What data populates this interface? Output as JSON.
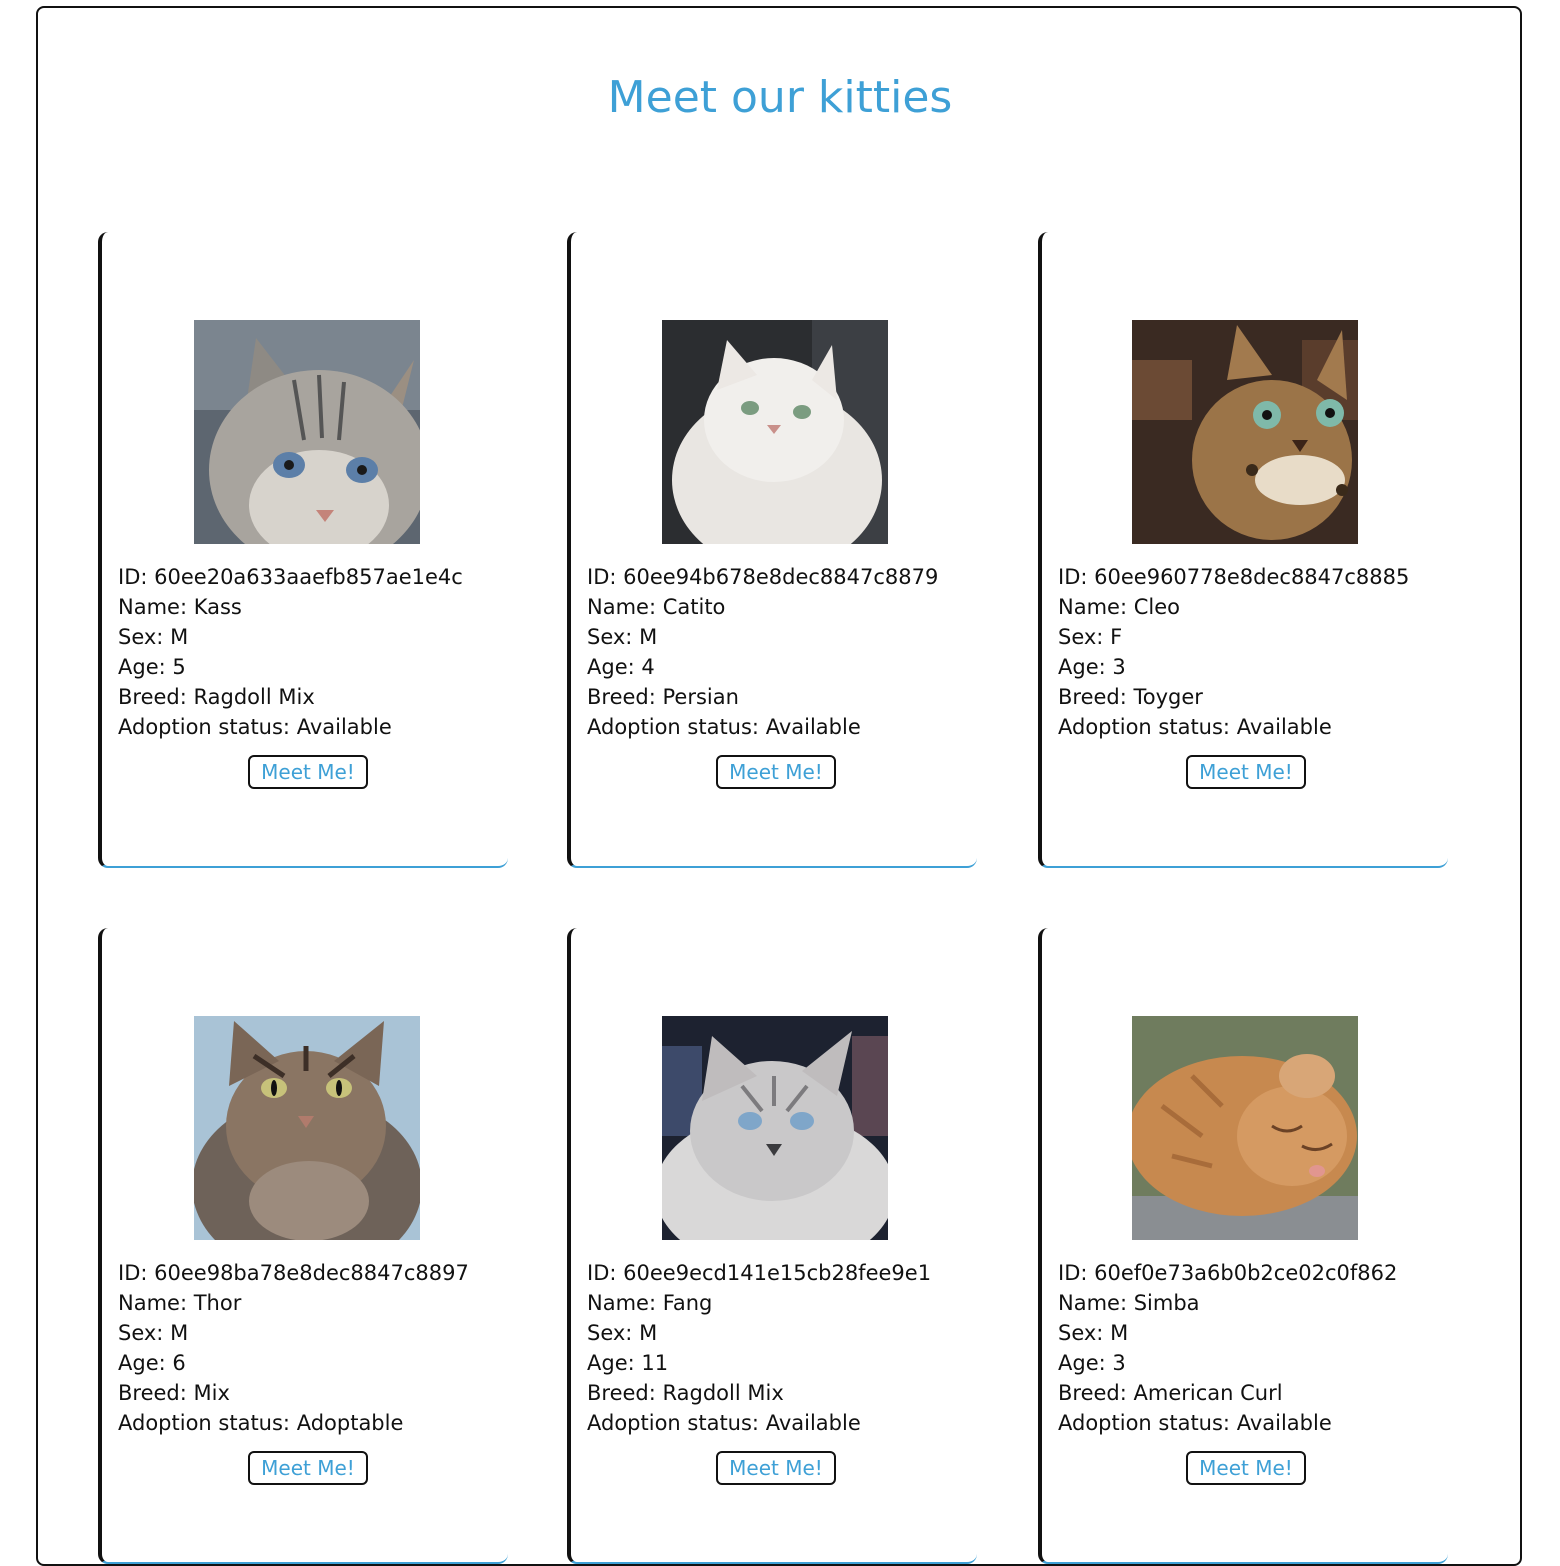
{
  "page": {
    "title": "Meet our kitties"
  },
  "labels": {
    "id": "ID:",
    "name": "Name:",
    "sex": "Sex:",
    "age": "Age:",
    "breed": "Breed:",
    "status": "Adoption status:",
    "button": "Meet Me!"
  },
  "cats": [
    {
      "id": "60ee20a633aaefb857ae1e4c",
      "name": "Kass",
      "sex": "M",
      "age": "5",
      "breed": "Ragdoll Mix",
      "status": "Available",
      "photo": "gray-tabby-cat-photo"
    },
    {
      "id": "60ee94b678e8dec8847c8879",
      "name": "Catito",
      "sex": "M",
      "age": "4",
      "breed": "Persian",
      "status": "Available",
      "photo": "white-persian-cat-photo"
    },
    {
      "id": "60ee960778e8dec8847c8885",
      "name": "Cleo",
      "sex": "F",
      "age": "3",
      "breed": "Toyger",
      "status": "Available",
      "photo": "spotted-bengal-cat-photo"
    },
    {
      "id": "60ee98ba78e8dec8847c8897",
      "name": "Thor",
      "sex": "M",
      "age": "6",
      "breed": "Mix",
      "status": "Adoptable",
      "photo": "tortoiseshell-cat-photo"
    },
    {
      "id": "60ee9ecd141e15cb28fee9e1",
      "name": "Fang",
      "sex": "M",
      "age": "11",
      "breed": "Ragdoll Mix",
      "status": "Available",
      "photo": "silver-longhair-cat-photo"
    },
    {
      "id": "60ef0e73a6b0b2ce02c0f862",
      "name": "Simba",
      "sex": "M",
      "age": "3",
      "breed": "American Curl",
      "status": "Available",
      "photo": "orange-sleeping-cat-photo"
    }
  ],
  "colors": {
    "accent": "#3ea0d6",
    "border": "#111111",
    "background": "#ffffff"
  }
}
